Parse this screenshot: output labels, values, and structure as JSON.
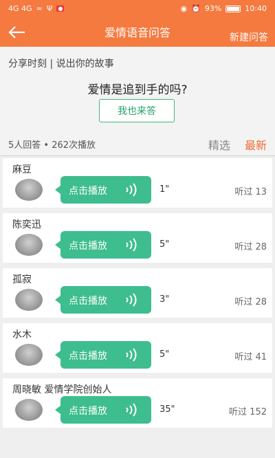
{
  "status_bar": {
    "signal": "4G 4G",
    "battery": "93%",
    "time": "10:40"
  },
  "header": {
    "title": "爱情语音问答",
    "new_question": "新建问答"
  },
  "question_card": {
    "share_text": "分享时刻 | 说出你的故事",
    "question": "爱情是追到手的吗?",
    "answer_button": "我也来答",
    "stats": "5人回答 •  262次播放",
    "filters": [
      "精选",
      "最新"
    ]
  },
  "answers": [
    {
      "name": "麻豆",
      "play_label": "点击播放",
      "duration": "1\"",
      "listened": "听过 13"
    },
    {
      "name": "陈奕迅",
      "play_label": "点击播放",
      "duration": "5\"",
      "listened": "听过 28"
    },
    {
      "name": "孤寂",
      "play_label": "点击播放",
      "duration": "3\"",
      "listened": "听过 28"
    },
    {
      "name": "水木",
      "play_label": "点击播放",
      "duration": "5\"",
      "listened": "听过 41"
    },
    {
      "name": "周晓敏 爱情学院创始人",
      "play_label": "点击播放",
      "duration": "35\"",
      "listened": "听过 152"
    }
  ],
  "colors": {
    "header": "#f47a3f",
    "play_button": "#3ebd8e",
    "active_filter": "#f26b37",
    "answer_button_border": "#40b37d"
  }
}
